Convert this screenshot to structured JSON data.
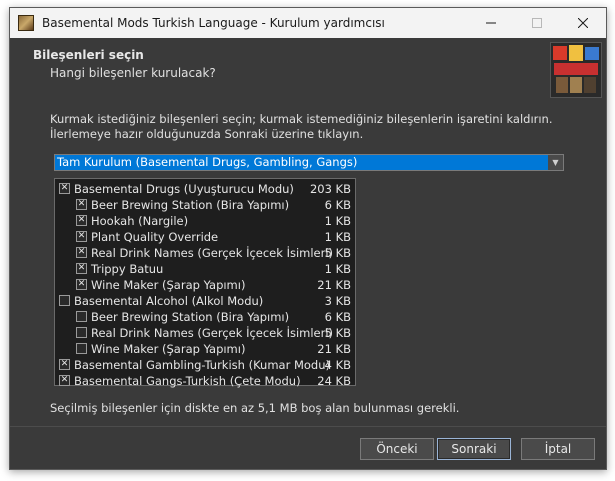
{
  "window": {
    "title": "Basemental Mods Turkish Language - Kurulum yardımcısı",
    "minimize_icon": "minimize-icon",
    "maximize_icon": "maximize-icon",
    "close_icon": "close-icon"
  },
  "header": {
    "title": "Bileşenleri seçin",
    "subtitle": "Hangi bileşenler kurulacak?"
  },
  "instructions": "Kurmak istediğiniz bileşenleri seçin; kurmak istemediğiniz bileşenlerin işaretini kaldırın. İlerlemeye hazır olduğunuzda Sonraki üzerine tıklayın.",
  "install_type": {
    "selected": "Tam Kurulum (Basemental Drugs, Gambling, Gangs)"
  },
  "components": [
    {
      "label": "Basemental Drugs (Uyuşturucu Modu)",
      "size": "203 KB",
      "checked": true,
      "level": 0
    },
    {
      "label": "Beer Brewing Station (Bira Yapımı)",
      "size": "6 KB",
      "checked": true,
      "level": 1
    },
    {
      "label": "Hookah (Nargile)",
      "size": "1 KB",
      "checked": true,
      "level": 1
    },
    {
      "label": "Plant Quality Override",
      "size": "1 KB",
      "checked": true,
      "level": 1
    },
    {
      "label": "Real Drink Names (Gerçek İçecek İsimleri)",
      "size": "5 KB",
      "checked": true,
      "level": 1
    },
    {
      "label": "Trippy Batuu",
      "size": "1 KB",
      "checked": true,
      "level": 1
    },
    {
      "label": "Wine Maker (Şarap Yapımı)",
      "size": "21 KB",
      "checked": true,
      "level": 1
    },
    {
      "label": "Basemental Alcohol (Alkol Modu)",
      "size": "3 KB",
      "checked": false,
      "level": 0
    },
    {
      "label": "Beer Brewing Station (Bira Yapımı)",
      "size": "6 KB",
      "checked": false,
      "level": 1
    },
    {
      "label": "Real Drink Names (Gerçek İçecek İsimleri)",
      "size": "5 KB",
      "checked": false,
      "level": 1
    },
    {
      "label": "Wine Maker (Şarap Yapımı)",
      "size": "21 KB",
      "checked": false,
      "level": 1
    },
    {
      "label": "Basemental Gambling-Turkish (Kumar Modu)",
      "size": "4 KB",
      "checked": true,
      "level": 0
    },
    {
      "label": "Basemental Gangs-Turkish (Çete Modu)",
      "size": "24 KB",
      "checked": true,
      "level": 0
    }
  ],
  "space_required": "Seçilmiş bileşenler için diskte en az 5,1 MB boş alan bulunması gerekli.",
  "buttons": {
    "back": "Önceki",
    "next": "Sonraki",
    "cancel": "İptal"
  },
  "colors": {
    "accent": "#0078d7",
    "background": "#3a3a3a",
    "list_background": "#1e1e1e"
  }
}
